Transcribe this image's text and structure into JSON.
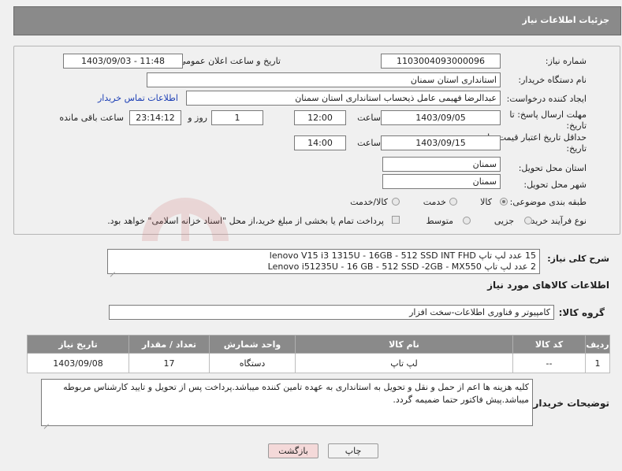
{
  "header": {
    "title": "جزئیات اطلاعات نیاز"
  },
  "form": {
    "need_number_label": "شماره نیاز:",
    "need_number": "1103004093000096",
    "announce_label": "تاریخ و ساعت اعلان عمومی:",
    "announce_value": "1403/09/03 - 11:48",
    "buyer_org_label": "نام دستگاه خریدار:",
    "buyer_org": "استانداری استان سمنان",
    "requester_label": "ایجاد کننده درخواست:",
    "requester": "عبدالرضا فهیمی عامل ذیحساب استانداری استان سمنان",
    "contact_link": "اطلاعات تماس خریدار",
    "deadline_label_1": "مهلت ارسال پاسخ: تا",
    "deadline_label_2": "تاریخ:",
    "deadline_date": "1403/09/05",
    "hour_label": "ساعت",
    "deadline_time": "12:00",
    "days_value": "1",
    "days_label": "روز و",
    "remaining_time": "23:14:12",
    "remaining_label": "ساعت باقی مانده",
    "validity_label_1": "حداقل تاریخ اعتبار قیمت: تا",
    "validity_label_2": "تاریخ:",
    "validity_date": "1403/09/15",
    "validity_time": "14:00",
    "province_label": "استان محل تحویل:",
    "province": "سمنان",
    "city_label": "شهر محل تحویل:",
    "city": "سمنان",
    "category_label": "طبقه بندی موضوعی:",
    "category_options": [
      "کالا",
      "خدمت",
      "کالا/خدمت"
    ],
    "category_selected": "کالا",
    "process_label": "نوع فرآیند خرید :",
    "process_options": [
      "جزیی",
      "متوسط"
    ],
    "payment_text": "پرداخت تمام یا بخشی از مبلغ خرید،از محل \"اسناد خزانه اسلامی\" خواهد بود."
  },
  "summary": {
    "label": "شرح کلی نیاز:",
    "line1": "15 عدد لپ تاپ lenovo V15 i3 1315U - 16GB - 512 SSD INT FHD",
    "line2": "2 عدد لپ تاپ Lenovo i51235U - 16 GB - 512 SSD -2GB - MX550"
  },
  "goods": {
    "section_title": "اطلاعات کالاهای مورد نیاز",
    "group_label": "گروه کالا:",
    "group_value": "کامپیوتر و فناوری اطلاعات-سخت افزار",
    "columns": [
      "ردیف",
      "کد کالا",
      "نام کالا",
      "واحد شمارش",
      "تعداد / مقدار",
      "تاریخ نیاز"
    ],
    "rows": [
      {
        "row": "1",
        "code": "--",
        "name": "لپ تاپ",
        "unit": "دستگاه",
        "qty": "17",
        "date": "1403/09/08"
      }
    ]
  },
  "buyer_notes": {
    "label": "توضیحات خریدار:",
    "text": "کلیه هزینه ها اعم از حمل و نقل و تحویل به استانداری به عهده تامین کننده میباشد.پرداخت پس از تحویل و تایید کارشناس مربوطه میباشد.پیش فاکتور حتما ضمیمه گردد."
  },
  "buttons": {
    "print": "چاپ",
    "back": "بازگشت"
  },
  "watermark": {
    "text": "AriaTender.net"
  },
  "colors": {
    "header_bg": "#8a8a8a",
    "link": "#1c3fb5",
    "back_button_bg": "#f4d9d9",
    "watermark": "#d27a7a"
  }
}
